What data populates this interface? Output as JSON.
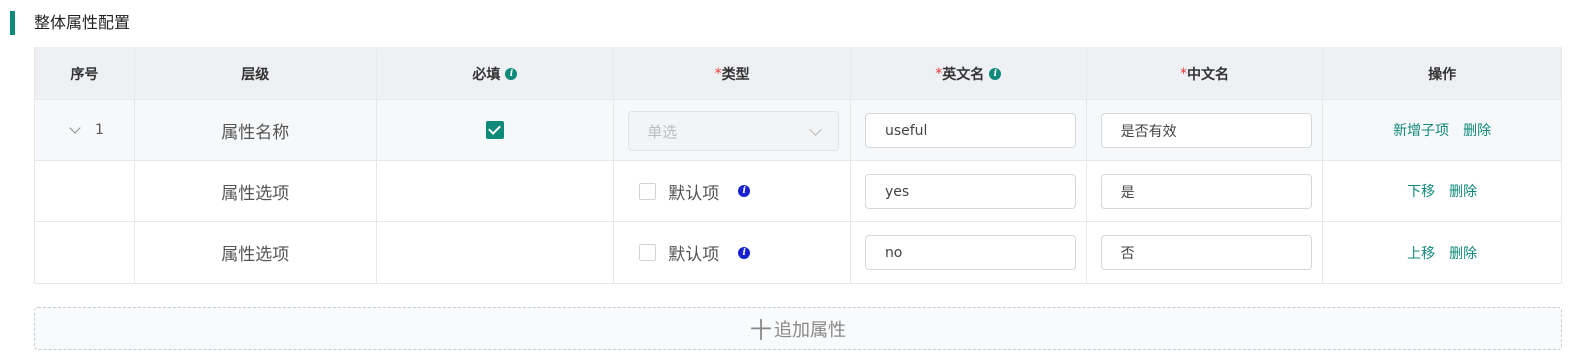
{
  "section": {
    "title": "整体属性配置"
  },
  "columns": {
    "seq": "序号",
    "level": "层级",
    "required": "必填",
    "type": "类型",
    "en_name": "英文名",
    "cn_name": "中文名",
    "actions": "操作",
    "required_mark": "*"
  },
  "rows": [
    {
      "seq": "1",
      "level": "属性名称",
      "required_checked": true,
      "type_placeholder": "单选",
      "en_value": "useful",
      "cn_value": "是否有效",
      "actions": [
        "新增子项",
        "删除"
      ]
    },
    {
      "level": "属性选项",
      "default_label": "默认项",
      "default_checked": false,
      "en_value": "yes",
      "cn_value": "是",
      "actions": [
        "下移",
        "删除"
      ]
    },
    {
      "level": "属性选项",
      "default_label": "默认项",
      "default_checked": false,
      "en_value": "no",
      "cn_value": "否",
      "actions": [
        "上移",
        "删除"
      ]
    }
  ],
  "add_button": {
    "label": "追加属性",
    "icon": "plus-icon"
  },
  "colors": {
    "accent": "#0f8a7a",
    "info_blue": "#1722d4",
    "required_star": "#e53935"
  }
}
